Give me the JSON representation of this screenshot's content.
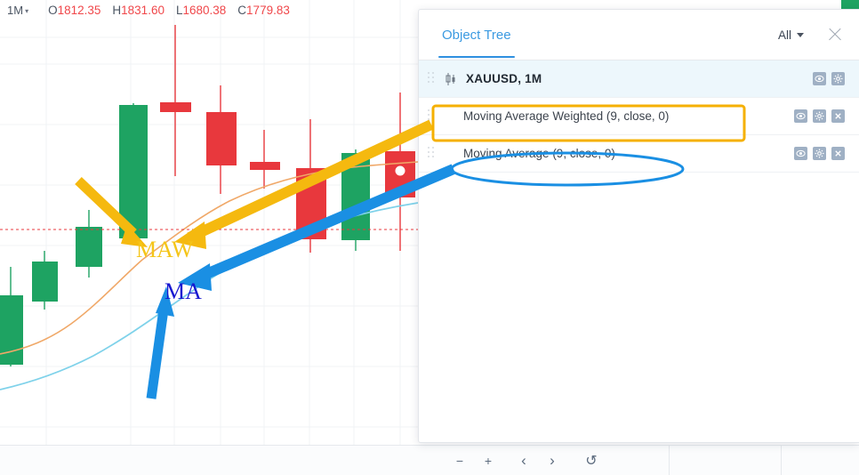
{
  "topbar": {
    "timeframe": "1M",
    "ohlc": [
      {
        "letter": "O",
        "value": "1812.35"
      },
      {
        "letter": "H",
        "value": "1831.60"
      },
      {
        "letter": "L",
        "value": "1680.38"
      },
      {
        "letter": "C",
        "value": "1779.83"
      }
    ]
  },
  "panel": {
    "tab_label": "Object Tree",
    "filter_label": "All",
    "rows": [
      {
        "label": "XAUUSD, 1M",
        "type": "symbol",
        "selected": true,
        "actions": [
          "eye-icon",
          "gear-icon"
        ]
      },
      {
        "label": "Moving Average Weighted (9, close, 0)",
        "type": "indicator",
        "selected": false,
        "actions": [
          "eye-icon",
          "gear-icon",
          "close-icon"
        ]
      },
      {
        "label": "Moving Average (9, close, 0)",
        "type": "indicator",
        "selected": false,
        "actions": [
          "eye-icon",
          "gear-icon",
          "close-icon"
        ]
      }
    ]
  },
  "toolbar": {
    "buttons": [
      {
        "name": "zoom-out-button",
        "glyph": "−"
      },
      {
        "name": "zoom-in-button",
        "glyph": "+"
      },
      {
        "name": "scroll-left-button",
        "glyph": "‹"
      },
      {
        "name": "scroll-right-button",
        "glyph": "›"
      },
      {
        "name": "reset-button",
        "glyph": "↺"
      }
    ]
  },
  "annotations": {
    "maw_label": "MAW",
    "ma_label": "MA",
    "maw_color": "#f5c518",
    "ma_color": "#1717d0",
    "arrow_orange": "#f5b90f",
    "arrow_blue": "#1a8fe3",
    "highlight_box_color": "#f5b000",
    "highlight_ellipse_color": "#1a8fe3"
  },
  "colors": {
    "bull": "#1ea362",
    "bear": "#e8383d",
    "ma_weighted_line": "#f0a868",
    "ma_line": "#7fd2ea",
    "price_line": "#e8383d",
    "grid": "#f0f2f4",
    "accent": "#2f90e0"
  },
  "chart_data": {
    "type": "candlestick",
    "symbol": "XAUUSD",
    "timeframe": "1M",
    "title": "",
    "xlabel": "",
    "ylabel": "",
    "grid": true,
    "price_line": 258,
    "candles": [
      {
        "x": 12,
        "open": 330,
        "high": 300,
        "low": 400,
        "close": 390,
        "dir": "up"
      },
      {
        "x": 50,
        "open": 330,
        "high": 282,
        "low": 345,
        "close": 295,
        "dir": "up"
      },
      {
        "x": 98,
        "open": 285,
        "high": 238,
        "low": 310,
        "close": 255,
        "dir": "up"
      },
      {
        "x": 148,
        "open": 265,
        "high": 118,
        "low": 272,
        "close": 120,
        "dir": "up"
      },
      {
        "x": 196,
        "open": 123,
        "high": 28,
        "low": 198,
        "close": 118,
        "dir": "down"
      },
      {
        "x": 247,
        "open": 130,
        "high": 98,
        "low": 218,
        "close": 185,
        "dir": "down"
      },
      {
        "x": 297,
        "open": 183,
        "high": 148,
        "low": 212,
        "close": 190,
        "dir": "down"
      },
      {
        "x": 348,
        "open": 178,
        "high": 135,
        "low": 285,
        "close": 268,
        "dir": "down"
      },
      {
        "x": 400,
        "open": 270,
        "high": 170,
        "low": 282,
        "close": 172,
        "dir": "up"
      },
      {
        "x": 450,
        "open": 215,
        "high": 105,
        "low": 283,
        "close": 172,
        "dir": "down"
      }
    ],
    "series": [
      {
        "name": "Moving Average Weighted (9, close, 0)",
        "color": "#f0a868"
      },
      {
        "name": "Moving Average (9, close, 0)",
        "color": "#7fd2ea"
      }
    ]
  }
}
